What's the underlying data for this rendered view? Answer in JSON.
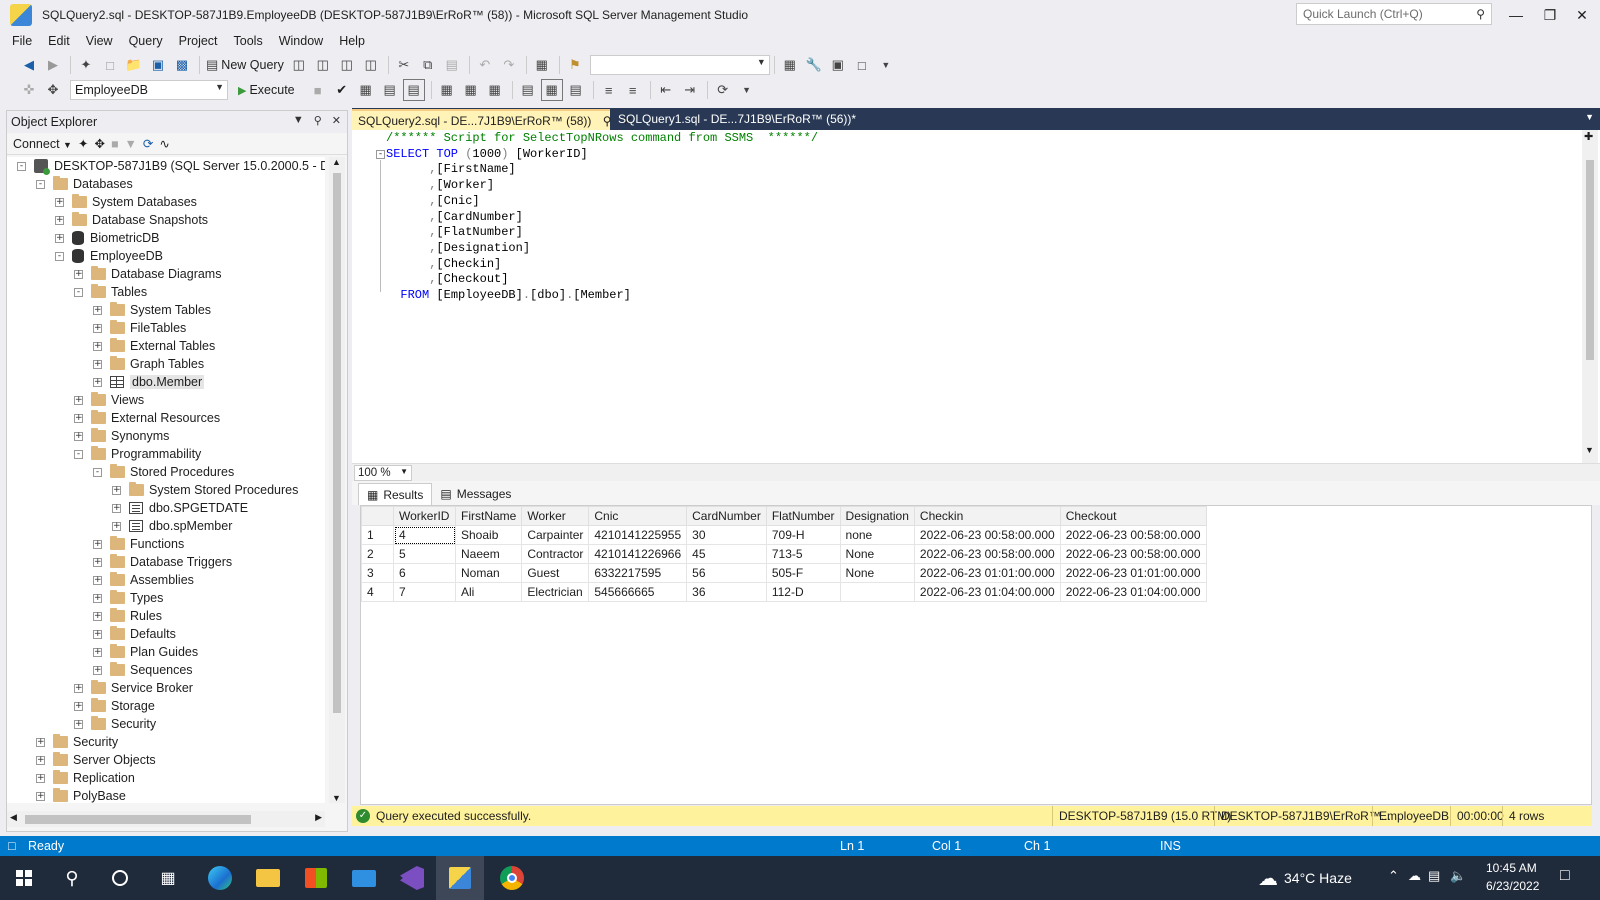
{
  "window": {
    "title": "SQLQuery2.sql - DESKTOP-587J1B9.EmployeeDB (DESKTOP-587J1B9\\ErRoR™ (58)) - Microsoft SQL Server Management Studio",
    "quick_launch_placeholder": "Quick Launch (Ctrl+Q)",
    "min_glyph": "—",
    "restore_glyph": "❐",
    "close_glyph": "✕"
  },
  "menu": [
    "File",
    "Edit",
    "View",
    "Query",
    "Project",
    "Tools",
    "Window",
    "Help"
  ],
  "toolbar1": {
    "new_query_label": "New Query"
  },
  "toolbar2": {
    "database": "EmployeeDB",
    "execute_label": "Execute"
  },
  "object_explorer": {
    "title": "Object Explorer",
    "connect_label": "Connect",
    "tree": [
      {
        "label": "DESKTOP-587J1B9 (SQL Server 15.0.2000.5 - DESKTOP",
        "indent": 0,
        "exp": "minus",
        "icon": "server"
      },
      {
        "label": "Databases",
        "indent": 1,
        "exp": "minus",
        "icon": "folder"
      },
      {
        "label": "System Databases",
        "indent": 2,
        "exp": "plus",
        "icon": "folder"
      },
      {
        "label": "Database Snapshots",
        "indent": 2,
        "exp": "plus",
        "icon": "folder"
      },
      {
        "label": "BiometricDB",
        "indent": 2,
        "exp": "plus",
        "icon": "database"
      },
      {
        "label": "EmployeeDB",
        "indent": 2,
        "exp": "minus",
        "icon": "database"
      },
      {
        "label": "Database Diagrams",
        "indent": 3,
        "exp": "plus",
        "icon": "folder"
      },
      {
        "label": "Tables",
        "indent": 3,
        "exp": "minus",
        "icon": "folder"
      },
      {
        "label": "System Tables",
        "indent": 4,
        "exp": "plus",
        "icon": "folder"
      },
      {
        "label": "FileTables",
        "indent": 4,
        "exp": "plus",
        "icon": "folder"
      },
      {
        "label": "External Tables",
        "indent": 4,
        "exp": "plus",
        "icon": "folder"
      },
      {
        "label": "Graph Tables",
        "indent": 4,
        "exp": "plus",
        "icon": "folder"
      },
      {
        "label": "dbo.Member",
        "indent": 4,
        "exp": "plus",
        "icon": "table"
      },
      {
        "label": "Views",
        "indent": 3,
        "exp": "plus",
        "icon": "folder"
      },
      {
        "label": "External Resources",
        "indent": 3,
        "exp": "plus",
        "icon": "folder"
      },
      {
        "label": "Synonyms",
        "indent": 3,
        "exp": "plus",
        "icon": "folder"
      },
      {
        "label": "Programmability",
        "indent": 3,
        "exp": "minus",
        "icon": "folder"
      },
      {
        "label": "Stored Procedures",
        "indent": 4,
        "exp": "minus",
        "icon": "folder"
      },
      {
        "label": "System Stored Procedures",
        "indent": 5,
        "exp": "plus",
        "icon": "folder"
      },
      {
        "label": "dbo.SPGETDATE",
        "indent": 5,
        "exp": "plus",
        "icon": "proc"
      },
      {
        "label": "dbo.spMember",
        "indent": 5,
        "exp": "plus",
        "icon": "proc"
      },
      {
        "label": "Functions",
        "indent": 4,
        "exp": "plus",
        "icon": "folder"
      },
      {
        "label": "Database Triggers",
        "indent": 4,
        "exp": "plus",
        "icon": "folder"
      },
      {
        "label": "Assemblies",
        "indent": 4,
        "exp": "plus",
        "icon": "folder"
      },
      {
        "label": "Types",
        "indent": 4,
        "exp": "plus",
        "icon": "folder"
      },
      {
        "label": "Rules",
        "indent": 4,
        "exp": "plus",
        "icon": "folder"
      },
      {
        "label": "Defaults",
        "indent": 4,
        "exp": "plus",
        "icon": "folder"
      },
      {
        "label": "Plan Guides",
        "indent": 4,
        "exp": "plus",
        "icon": "folder"
      },
      {
        "label": "Sequences",
        "indent": 4,
        "exp": "plus",
        "icon": "folder"
      },
      {
        "label": "Service Broker",
        "indent": 3,
        "exp": "plus",
        "icon": "folder"
      },
      {
        "label": "Storage",
        "indent": 3,
        "exp": "plus",
        "icon": "folder"
      },
      {
        "label": "Security",
        "indent": 3,
        "exp": "plus",
        "icon": "folder"
      },
      {
        "label": "Security",
        "indent": 1,
        "exp": "plus",
        "icon": "folder"
      },
      {
        "label": "Server Objects",
        "indent": 1,
        "exp": "plus",
        "icon": "folder"
      },
      {
        "label": "Replication",
        "indent": 1,
        "exp": "plus",
        "icon": "folder"
      },
      {
        "label": "PolyBase",
        "indent": 1,
        "exp": "plus",
        "icon": "folder"
      }
    ]
  },
  "tabs": {
    "active": "SQLQuery2.sql - DE...7J1B9\\ErRoR™ (58))",
    "inactive": "SQLQuery1.sql - DE...7J1B9\\ErRoR™ (56))*"
  },
  "editor": {
    "lines": [
      [
        {
          "c": "cm",
          "t": "/****** Script for SelectTopNRows command from SSMS  ******/"
        }
      ],
      [
        {
          "c": "kw",
          "t": "SELECT TOP "
        },
        {
          "c": "gr",
          "t": "("
        },
        {
          "c": "tx",
          "t": "1000"
        },
        {
          "c": "gr",
          "t": ")"
        },
        {
          "c": "tx",
          "t": " [WorkerID]"
        }
      ],
      [
        {
          "c": "gr",
          "t": "      ,"
        },
        {
          "c": "tx",
          "t": "[FirstName]"
        }
      ],
      [
        {
          "c": "gr",
          "t": "      ,"
        },
        {
          "c": "tx",
          "t": "[Worker]"
        }
      ],
      [
        {
          "c": "gr",
          "t": "      ,"
        },
        {
          "c": "tx",
          "t": "[Cnic]"
        }
      ],
      [
        {
          "c": "gr",
          "t": "      ,"
        },
        {
          "c": "tx",
          "t": "[CardNumber]"
        }
      ],
      [
        {
          "c": "gr",
          "t": "      ,"
        },
        {
          "c": "tx",
          "t": "[FlatNumber]"
        }
      ],
      [
        {
          "c": "gr",
          "t": "      ,"
        },
        {
          "c": "tx",
          "t": "[Designation]"
        }
      ],
      [
        {
          "c": "gr",
          "t": "      ,"
        },
        {
          "c": "tx",
          "t": "[Checkin]"
        }
      ],
      [
        {
          "c": "gr",
          "t": "      ,"
        },
        {
          "c": "tx",
          "t": "[Checkout]"
        }
      ],
      [
        {
          "c": "kw",
          "t": "  FROM "
        },
        {
          "c": "tx",
          "t": "[EmployeeDB]"
        },
        {
          "c": "gr",
          "t": "."
        },
        {
          "c": "tx",
          "t": "[dbo]"
        },
        {
          "c": "gr",
          "t": "."
        },
        {
          "c": "tx",
          "t": "[Member]"
        }
      ]
    ],
    "zoom": "100 %"
  },
  "results": {
    "tab_results": "Results",
    "tab_messages": "Messages",
    "columns": [
      "WorkerID",
      "FirstName",
      "Worker",
      "Cnic",
      "CardNumber",
      "FlatNumber",
      "Designation",
      "Checkin",
      "Checkout"
    ],
    "rows": [
      [
        "1",
        "4",
        "Shoaib",
        "Carpainter",
        "4210141225955",
        "30",
        "709-H",
        "none",
        "2022-06-23 00:58:00.000",
        "2022-06-23 00:58:00.000"
      ],
      [
        "2",
        "5",
        "Naeem",
        "Contractor",
        "4210141226966",
        "45",
        "713-5",
        "None",
        "2022-06-23 00:58:00.000",
        "2022-06-23 00:58:00.000"
      ],
      [
        "3",
        "6",
        "Noman",
        "Guest",
        "6332217595",
        "56",
        "505-F",
        "None",
        "2022-06-23 01:01:00.000",
        "2022-06-23 01:01:00.000"
      ],
      [
        "4",
        "7",
        "Ali",
        "Electrician",
        "545666665",
        "36",
        "112-D",
        "",
        "2022-06-23 01:04:00.000",
        "2022-06-23 01:04:00.000"
      ]
    ]
  },
  "query_status": {
    "message": "Query executed successfully.",
    "server": "DESKTOP-587J1B9 (15.0 RTM)",
    "user": "DESKTOP-587J1B9\\ErRoR™...",
    "database": "EmployeeDB",
    "elapsed": "00:00:00",
    "rows": "4 rows"
  },
  "status_bar": {
    "ready": "Ready",
    "ln": "Ln 1",
    "col": "Col 1",
    "ch": "Ch 1",
    "mode": "INS"
  },
  "taskbar": {
    "weather": "34°C  Haze",
    "time": "10:45 AM",
    "date": "6/23/2022"
  },
  "colors": {
    "accent": "#007acc",
    "tab_strip": "#293955",
    "active_tab": "#fff3b8",
    "status_yellow": "#fff29d"
  }
}
